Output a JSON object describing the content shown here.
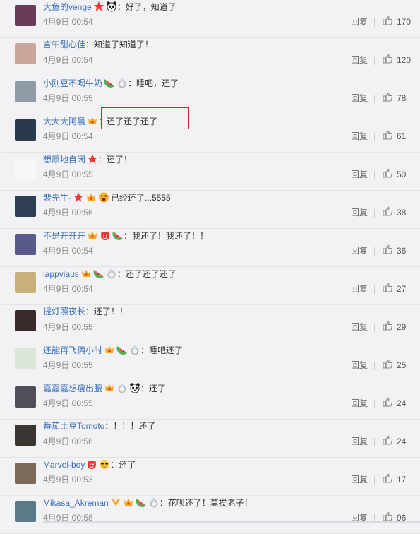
{
  "reply_label": "回复",
  "icons": {
    "like": "thumbs-up-icon",
    "star": "red-star-icon",
    "panda": "panda-emoji",
    "crown": "member-crown-icon",
    "watermelon": "watermelon-emoji",
    "devil": "devil-emoji",
    "cool": "sunglasses-emoji",
    "shock": "shocked-emoji",
    "v": "verified-v-icon",
    "ring": "ring-emoji"
  },
  "colors": {
    "username": "#3a6fb7",
    "highlight_border": "#d0262e",
    "star": "#e33",
    "crown": "#f5a623"
  },
  "comments": [
    {
      "user": "大鱼的venge",
      "badges": [
        "star",
        "panda"
      ],
      "text": "：好了，知道了",
      "time": "4月9日 00:54",
      "reply": "回复",
      "likes": "170",
      "avatar": "#6b3b5c"
    },
    {
      "user": "言午甜心佳",
      "badges": [],
      "text": "：知道了知道了！",
      "time": "4月9日 00:54",
      "reply": "回复",
      "likes": "120",
      "avatar": "#c9a79d"
    },
    {
      "user": "小刚豆不喝牛奶",
      "badges": [
        "watermelon",
        "ring"
      ],
      "text": "：睡吧，还了",
      "time": "4月9日 00:55",
      "reply": "回复",
      "likes": "78",
      "avatar": "#8e9aa6"
    },
    {
      "user": "大大大阿晨",
      "badges": [
        "crown"
      ],
      "text": "：还了还了还了",
      "time": "4月9日 00:54",
      "reply": "回复",
      "likes": "61",
      "avatar": "#2b3a4a"
    },
    {
      "user": "想原地自闭",
      "badges": [
        "star"
      ],
      "text": "：还了！",
      "time": "4月9日 00:55",
      "reply": "回复",
      "likes": "50",
      "avatar": "#f7f7f7"
    },
    {
      "user": "裴先生-",
      "badges": [
        "star",
        "crown",
        "shock"
      ],
      "text": "已经还了...5555",
      "time": "4月9日 00:56",
      "reply": "回复",
      "likes": "38",
      "avatar": "#2e3e55"
    },
    {
      "user": "不是开开开",
      "badges": [
        "crown",
        "devil",
        "watermelon"
      ],
      "text": "：我还了！我还了！！",
      "time": "4月9日 00:54",
      "reply": "回复",
      "likes": "36",
      "avatar": "#5a5a8a"
    },
    {
      "user": "lappviaus",
      "badges": [
        "crown",
        "watermelon",
        "ring"
      ],
      "text": "：还了还了还了",
      "time": "4月9日 00:54",
      "reply": "回复",
      "likes": "27",
      "avatar": "#c8b07a"
    },
    {
      "user": "提灯照夜长",
      "badges": [],
      "text": "：还了！！",
      "time": "4月9日 00:55",
      "reply": "回复",
      "likes": "29",
      "avatar": "#3b2a2a"
    },
    {
      "user": "还能再飞俩小时",
      "badges": [
        "crown",
        "watermelon",
        "ring"
      ],
      "text": "：睡吧还了",
      "time": "4月9日 00:55",
      "reply": "回复",
      "likes": "25",
      "avatar": "#d9e6d9"
    },
    {
      "user": "嘉嘉嘉想瘦出腰",
      "badges": [
        "crown",
        "ring",
        "panda"
      ],
      "text": "：还了",
      "time": "4月9日 00:55",
      "reply": "回复",
      "likes": "24",
      "avatar": "#4f4f5a"
    },
    {
      "user": "番茄土豆Tomoto",
      "badges": [],
      "text": "：！！！还了",
      "time": "4月9日 00:56",
      "reply": "回复",
      "likes": "24",
      "avatar": "#3a3530"
    },
    {
      "user": "Marvel-boy",
      "badges": [
        "devil",
        "cool"
      ],
      "text": "：还了",
      "time": "4月9日 00:53",
      "reply": "回复",
      "likes": "17",
      "avatar": "#7a6a5a"
    },
    {
      "user": "Mikasa_Akreman",
      "badges": [
        "v",
        "crown",
        "watermelon",
        "ring"
      ],
      "text": "：花呗还了！莫挨老子！",
      "time": "4月9日 00:58",
      "reply": "回复",
      "likes": "96",
      "avatar": "#5a7a8a"
    }
  ]
}
